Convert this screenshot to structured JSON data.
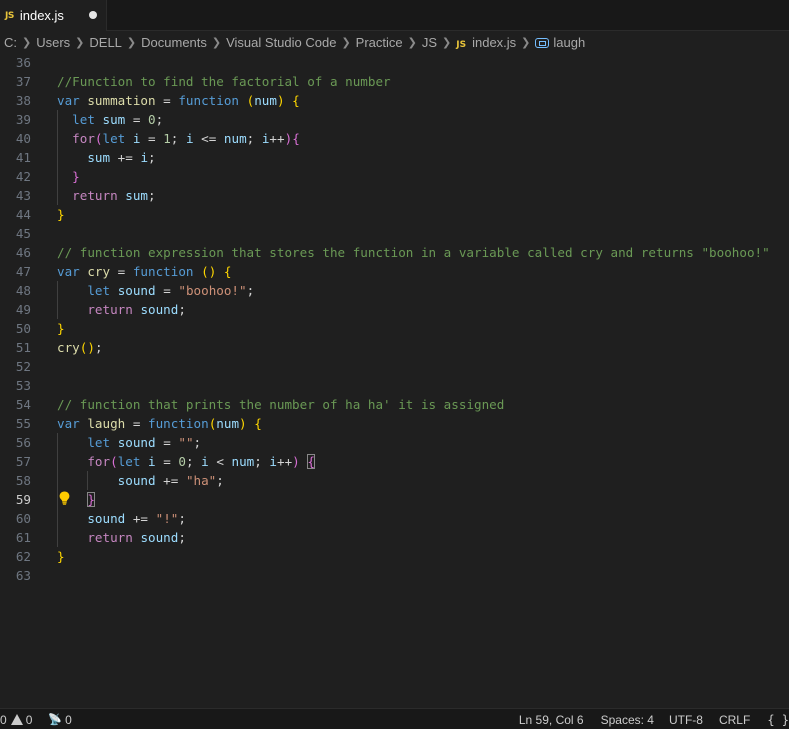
{
  "tab": {
    "badge": "JS",
    "label": "index.js"
  },
  "breadcrumb": {
    "items": [
      "C:",
      "Users",
      "DELL",
      "Documents",
      "Visual Studio Code",
      "Practice",
      "JS"
    ],
    "file_badge": "JS",
    "file": "index.js",
    "symbol": "laugh"
  },
  "editor": {
    "active_line": 59,
    "lines": [
      {
        "n": "36",
        "tokens": []
      },
      {
        "n": "37",
        "tokens": [
          [
            "com",
            "//Function to find the factorial of a number"
          ]
        ]
      },
      {
        "n": "38",
        "tokens": [
          [
            "kw",
            "var"
          ],
          [
            "op",
            " "
          ],
          [
            "fn",
            "summation"
          ],
          [
            "op",
            " = "
          ],
          [
            "kw",
            "function"
          ],
          [
            "op",
            " "
          ],
          [
            "p1",
            "("
          ],
          [
            "var",
            "num"
          ],
          [
            "p1",
            ")"
          ],
          [
            "op",
            " "
          ],
          [
            "p1",
            "{"
          ]
        ]
      },
      {
        "n": "39",
        "indent": 1,
        "tokens": [
          [
            "op",
            "  "
          ],
          [
            "kw",
            "let"
          ],
          [
            "op",
            " "
          ],
          [
            "var",
            "sum"
          ],
          [
            "op",
            " = "
          ],
          [
            "num",
            "0"
          ],
          [
            "op",
            ";"
          ]
        ]
      },
      {
        "n": "40",
        "indent": 1,
        "tokens": [
          [
            "op",
            "  "
          ],
          [
            "ctl",
            "for"
          ],
          [
            "p2",
            "("
          ],
          [
            "kw",
            "let"
          ],
          [
            "op",
            " "
          ],
          [
            "var",
            "i"
          ],
          [
            "op",
            " = "
          ],
          [
            "num",
            "1"
          ],
          [
            "op",
            "; "
          ],
          [
            "var",
            "i"
          ],
          [
            "op",
            " <= "
          ],
          [
            "var",
            "num"
          ],
          [
            "op",
            "; "
          ],
          [
            "var",
            "i"
          ],
          [
            "op",
            "++"
          ],
          [
            "p2",
            ")"
          ],
          [
            "p2",
            "{"
          ]
        ]
      },
      {
        "n": "41",
        "indent": 1,
        "tokens": [
          [
            "op",
            "    "
          ],
          [
            "var",
            "sum"
          ],
          [
            "op",
            " += "
          ],
          [
            "var",
            "i"
          ],
          [
            "op",
            ";"
          ]
        ]
      },
      {
        "n": "42",
        "indent": 1,
        "tokens": [
          [
            "op",
            "  "
          ],
          [
            "p2",
            "}"
          ]
        ]
      },
      {
        "n": "43",
        "indent": 1,
        "tokens": [
          [
            "op",
            "  "
          ],
          [
            "ctl",
            "return"
          ],
          [
            "op",
            " "
          ],
          [
            "var",
            "sum"
          ],
          [
            "op",
            ";"
          ]
        ]
      },
      {
        "n": "44",
        "tokens": [
          [
            "p1",
            "}"
          ]
        ]
      },
      {
        "n": "45",
        "tokens": []
      },
      {
        "n": "46",
        "tokens": [
          [
            "com",
            "// function expression that stores the function in a variable called cry and returns \"boohoo!\""
          ]
        ]
      },
      {
        "n": "47",
        "tokens": [
          [
            "kw",
            "var"
          ],
          [
            "op",
            " "
          ],
          [
            "fn",
            "cry"
          ],
          [
            "op",
            " = "
          ],
          [
            "kw",
            "function"
          ],
          [
            "op",
            " "
          ],
          [
            "p1",
            "("
          ],
          [
            "p1",
            ")"
          ],
          [
            "op",
            " "
          ],
          [
            "p1",
            "{"
          ]
        ]
      },
      {
        "n": "48",
        "indent": 1,
        "tokens": [
          [
            "op",
            "    "
          ],
          [
            "kw",
            "let"
          ],
          [
            "op",
            " "
          ],
          [
            "var",
            "sound"
          ],
          [
            "op",
            " = "
          ],
          [
            "str",
            "\"boohoo!\""
          ],
          [
            "op",
            ";"
          ]
        ]
      },
      {
        "n": "49",
        "indent": 1,
        "tokens": [
          [
            "op",
            "    "
          ],
          [
            "ctl",
            "return"
          ],
          [
            "op",
            " "
          ],
          [
            "var",
            "sound"
          ],
          [
            "op",
            ";"
          ]
        ]
      },
      {
        "n": "50",
        "tokens": [
          [
            "p1",
            "}"
          ]
        ]
      },
      {
        "n": "51",
        "tokens": [
          [
            "fn",
            "cry"
          ],
          [
            "p1",
            "("
          ],
          [
            "p1",
            ")"
          ],
          [
            "op",
            ";"
          ]
        ]
      },
      {
        "n": "52",
        "tokens": []
      },
      {
        "n": "53",
        "tokens": []
      },
      {
        "n": "54",
        "tokens": [
          [
            "com",
            "// function that prints the number of ha ha' it is assigned"
          ]
        ]
      },
      {
        "n": "55",
        "tokens": [
          [
            "kw",
            "var"
          ],
          [
            "op",
            " "
          ],
          [
            "fn",
            "laugh"
          ],
          [
            "op",
            " = "
          ],
          [
            "kw",
            "function"
          ],
          [
            "p1",
            "("
          ],
          [
            "var",
            "num"
          ],
          [
            "p1",
            ")"
          ],
          [
            "op",
            " "
          ],
          [
            "p1",
            "{"
          ]
        ]
      },
      {
        "n": "56",
        "indent": 1,
        "tokens": [
          [
            "op",
            "    "
          ],
          [
            "kw",
            "let"
          ],
          [
            "op",
            " "
          ],
          [
            "var",
            "sound"
          ],
          [
            "op",
            " = "
          ],
          [
            "str",
            "\"\""
          ],
          [
            "op",
            ";"
          ]
        ]
      },
      {
        "n": "57",
        "indent": 1,
        "tokens": [
          [
            "op",
            "    "
          ],
          [
            "ctl",
            "for"
          ],
          [
            "p2",
            "("
          ],
          [
            "kw",
            "let"
          ],
          [
            "op",
            " "
          ],
          [
            "var",
            "i"
          ],
          [
            "op",
            " = "
          ],
          [
            "num",
            "0"
          ],
          [
            "op",
            "; "
          ],
          [
            "var",
            "i"
          ],
          [
            "op",
            " < "
          ],
          [
            "var",
            "num"
          ],
          [
            "op",
            "; "
          ],
          [
            "var",
            "i"
          ],
          [
            "op",
            "++"
          ],
          [
            "p2",
            ")"
          ],
          [
            "op",
            " "
          ],
          [
            "p2m",
            "{"
          ]
        ]
      },
      {
        "n": "58",
        "indent": 2,
        "tokens": [
          [
            "op",
            "        "
          ],
          [
            "var",
            "sound"
          ],
          [
            "op",
            " += "
          ],
          [
            "str",
            "\"ha\""
          ],
          [
            "op",
            ";"
          ]
        ]
      },
      {
        "n": "59",
        "indent": 1,
        "tokens": [
          [
            "op",
            "    "
          ],
          [
            "p2m",
            "}"
          ]
        ]
      },
      {
        "n": "60",
        "indent": 1,
        "tokens": [
          [
            "op",
            "    "
          ],
          [
            "var",
            "sound"
          ],
          [
            "op",
            " += "
          ],
          [
            "str",
            "\"!\""
          ],
          [
            "op",
            ";"
          ]
        ]
      },
      {
        "n": "61",
        "indent": 1,
        "tokens": [
          [
            "op",
            "    "
          ],
          [
            "ctl",
            "return"
          ],
          [
            "op",
            " "
          ],
          [
            "var",
            "sound"
          ],
          [
            "op",
            ";"
          ]
        ]
      },
      {
        "n": "62",
        "tokens": [
          [
            "p1",
            "}"
          ]
        ]
      },
      {
        "n": "63",
        "tokens": []
      }
    ]
  },
  "status": {
    "errors": "0",
    "warnings": "0",
    "ports": "0",
    "position": "Ln 59, Col 6",
    "spaces": "Spaces: 4",
    "encoding": "UTF-8",
    "eol": "CRLF",
    "language_icon": "{ }"
  },
  "colors": {
    "background": "#1f1f1f",
    "comment": "#6a9955",
    "keyword": "#569cd6",
    "string": "#ce9178",
    "function": "#dcdcaa",
    "variable": "#9cdcfe",
    "bracket_level1": "#ffd700",
    "bracket_level2": "#da70d6",
    "js_badge": "#e8c43a"
  }
}
